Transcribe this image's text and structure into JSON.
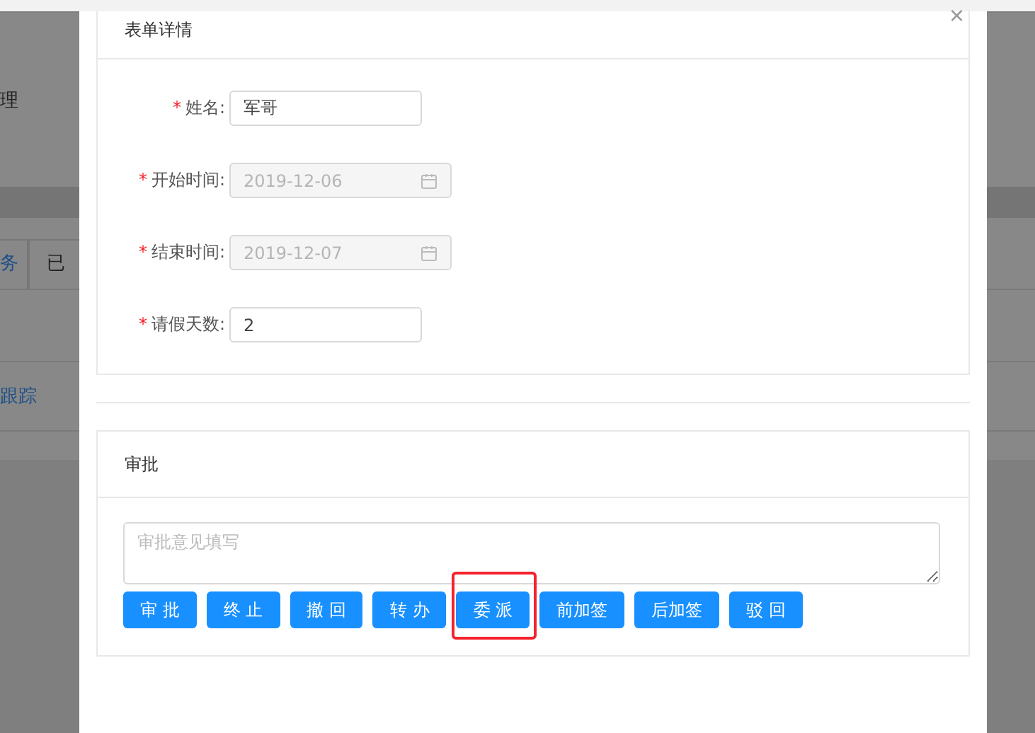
{
  "background_page": {
    "section_title": "理",
    "tabs": [
      {
        "label": "务",
        "selected": true
      },
      {
        "label": "已",
        "selected": false
      }
    ],
    "row_link": "跟踪"
  },
  "modal": {
    "close": "×",
    "form_card": {
      "title": "表单详情",
      "fields": [
        {
          "label": "姓名:",
          "required_mark": "*",
          "kind": "text",
          "value": "军哥",
          "disabled": false
        },
        {
          "label": "开始时间:",
          "required_mark": "*",
          "kind": "date",
          "value": "2019-12-06",
          "disabled": true
        },
        {
          "label": "结束时间:",
          "required_mark": "*",
          "kind": "date",
          "value": "2019-12-07",
          "disabled": true
        },
        {
          "label": "请假天数:",
          "required_mark": "*",
          "kind": "text",
          "value": "2",
          "disabled": false
        }
      ]
    },
    "approval_card": {
      "title": "审批",
      "comment": {
        "placeholder": "审批意见填写"
      },
      "buttons": [
        {
          "label": "审 批"
        },
        {
          "label": "终 止"
        },
        {
          "label": "撤 回"
        },
        {
          "label": "转 办"
        },
        {
          "label": "委 派",
          "highlighted": true
        },
        {
          "label": "前加签"
        },
        {
          "label": "后加签"
        },
        {
          "label": "驳 回"
        }
      ]
    }
  }
}
